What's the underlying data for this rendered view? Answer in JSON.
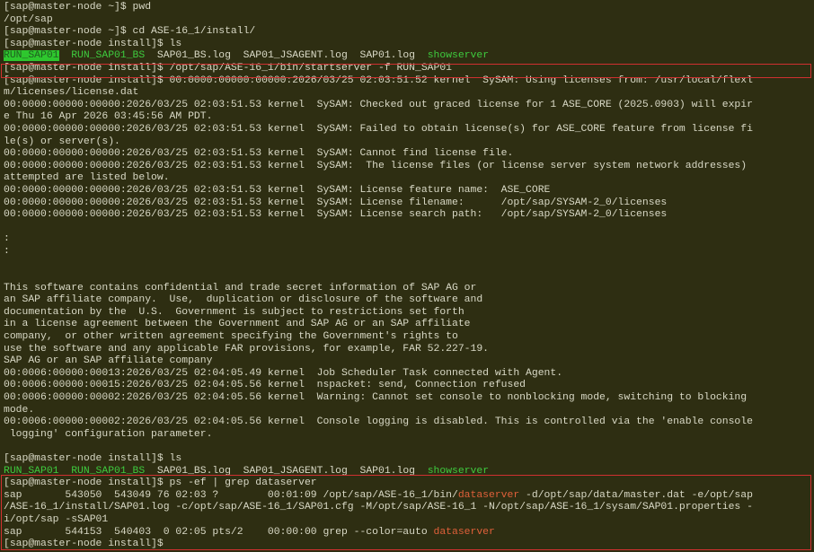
{
  "terminal": {
    "block1": [
      "[sap@master-node ~]$ pwd",
      "/opt/sap",
      "[sap@master-node ~]$ cd ASE-16_1/install/",
      "[sap@master-node install]$ ls"
    ],
    "ls1": {
      "f1": "RUN_SAP01",
      "f2": "RUN_SAP01_BS",
      "f3": "SAP01_BS.log",
      "f4": "SAP01_JSAGENT.log",
      "f5": "SAP01.log",
      "f6": "showserver"
    },
    "startserver_cmd": "[sap@master-node install]$ /opt/sap/ASE-16_1/bin/startserver -f RUN_SAP01",
    "log1": [
      "[sap@master-node install]$ 00:0000:00000:00000:2026/03/25 02:03:51.52 kernel  SySAM: Using licenses from: /usr/local/flexl",
      "m/licenses/license.dat",
      "00:0000:00000:00000:2026/03/25 02:03:51.53 kernel  SySAM: Checked out graced license for 1 ASE_CORE (2025.0903) will expir",
      "e Thu 16 Apr 2026 03:45:56 AM PDT.",
      "00:0000:00000:00000:2026/03/25 02:03:51.53 kernel  SySAM: Failed to obtain license(s) for ASE_CORE feature from license fi",
      "le(s) or server(s).",
      "00:0000:00000:00000:2026/03/25 02:03:51.53 kernel  SySAM: Cannot find license file.",
      "00:0000:00000:00000:2026/03/25 02:03:51.53 kernel  SySAM:  The license files (or license server system network addresses)",
      "attempted are listed below.",
      "00:0000:00000:00000:2026/03/25 02:03:51.53 kernel  SySAM: License feature name:  ASE_CORE",
      "00:0000:00000:00000:2026/03/25 02:03:51.53 kernel  SySAM: License filename:      /opt/sap/SYSAM-2_0/licenses",
      "00:0000:00000:00000:2026/03/25 02:03:51.53 kernel  SySAM: License search path:   /opt/sap/SYSAM-2_0/licenses",
      "",
      ":",
      ":",
      "",
      "",
      "This software contains confidential and trade secret information of SAP AG or",
      "an SAP affiliate company.  Use,  duplication or disclosure of the software and",
      "documentation by the  U.S.  Government is subject to restrictions set forth",
      "in a license agreement between the Government and SAP AG or an SAP affiliate",
      "company,  or other written agreement specifying the Government's rights to",
      "use the software and any applicable FAR provisions, for example, FAR 52.227-19.",
      "SAP AG or an SAP affiliate company",
      "00:0006:00000:00013:2026/03/25 02:04:05.49 kernel  Job Scheduler Task connected with Agent.",
      "00:0006:00000:00015:2026/03/25 02:04:05.56 kernel  nspacket: send, Connection refused",
      "00:0006:00000:00002:2026/03/25 02:04:05.56 kernel  Warning: Cannot set console to nonblocking mode, switching to blocking",
      "mode.",
      "00:0006:00000:00002:2026/03/25 02:04:05.56 kernel  Console logging is disabled. This is controlled via the 'enable console",
      " logging' configuration parameter.",
      "",
      "[sap@master-node install]$ ls"
    ],
    "ls2": {
      "f1": "RUN_SAP01",
      "f2": "RUN_SAP01_BS",
      "f3": "SAP01_BS.log",
      "f4": "SAP01_JSAGENT.log",
      "f5": "SAP01.log",
      "f6": "showserver"
    },
    "ps_block": {
      "cmd": "[sap@master-node install]$ ps -ef | grep dataserver",
      "row1_pre": "sap       543050  543049 76 02:03 ?        00:01:09 /opt/sap/ASE-16_1/bin/",
      "row1_hl": "dataserver",
      "row1_post": " -d/opt/sap/data/master.dat -e/opt/sap",
      "row1_cont1": "/ASE-16_1/install/SAP01.log -c/opt/sap/ASE-16_1/SAP01.cfg -M/opt/sap/ASE-16_1 -N/opt/sap/ASE-16_1/sysam/SAP01.properties -",
      "row1_cont2": "i/opt/sap -sSAP01",
      "row2_pre": "sap       544153  540403  0 02:05 pts/2    00:00:00 grep --color=auto ",
      "row2_hl": "dataserver",
      "prompt": "[sap@master-node install]$ "
    }
  },
  "colors": {
    "background": "#2e2e12",
    "text": "#d9d9c6",
    "executable": "#3ecb3e",
    "highlight_box": "#d03030",
    "grep_match": "#e0603a"
  }
}
